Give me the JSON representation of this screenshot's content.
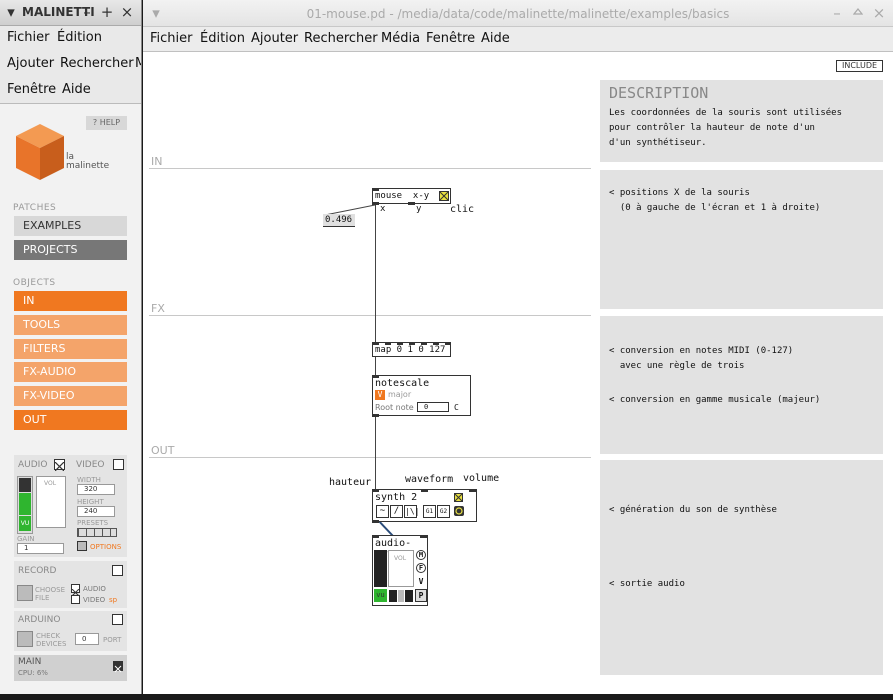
{
  "left_window": {
    "title": "MALINETTI",
    "controls": [
      "▾",
      "–",
      "+",
      "×"
    ],
    "menu": {
      "row1": [
        "Fichier",
        "Édition"
      ],
      "row2": [
        "Ajouter",
        "Rechercher",
        "M"
      ],
      "row3": [
        "Fenêtre",
        "Aide"
      ]
    },
    "help_label": "? HELP",
    "logo_text_1": "la",
    "logo_text_2": "malinette",
    "patches_label": "PATCHES",
    "patches": [
      "EXAMPLES",
      "PROJECTS"
    ],
    "objects_label": "OBJECTS",
    "objects": [
      "IN",
      "TOOLS",
      "FILTERS",
      "FX-AUDIO",
      "FX-VIDEO",
      "OUT"
    ],
    "audio_label": "AUDIO",
    "video_label": "VIDEO",
    "vol_label": "VOL",
    "vu_label": "VU",
    "gain_label": "GAIN",
    "gain_value": "1",
    "width_label": "WIDTH",
    "width_value": "320",
    "height_label": "HEIGHT",
    "height_value": "240",
    "presets_label": "PRESETS",
    "options_label": "OPTIONS",
    "record_label": "RECORD",
    "choose_file_label": "CHOOSE FILE",
    "rec_audio_label": "AUDIO",
    "rec_video_label": "VIDEO",
    "rec_video_suffix": "sp",
    "arduino_label": "ARDUINO",
    "check_devices_label": "CHECK DEVICES",
    "port_value": "0",
    "port_label": "PORT",
    "main_label": "MAIN",
    "cpu_label": "CPU: 6%"
  },
  "main_window": {
    "title": "01-mouse.pd - /media/data/code/malinette/malinette/examples/basics",
    "controls": [
      "▾",
      "–",
      "×"
    ],
    "menu": [
      "Fichier",
      "Édition",
      "Ajouter",
      "Rechercher",
      "Média",
      "Fenêtre",
      "Aide"
    ],
    "include_label": "INCLUDE",
    "sections": [
      "IN",
      "FX",
      "OUT"
    ],
    "description_title": "DESCRIPTION",
    "description_text": "Les coordonnées de la souris sont utilisées\npour contrôler la hauteur de note d'un\nd'un synthétiseur.",
    "comments": [
      "< positions X de la souris\n  (0 à gauche de l'écran et 1 à droite)",
      "< conversion en notes MIDI (0-127)\n  avec une règle de trois",
      "< conversion en gamme musicale (majeur)",
      "< génération du son de synthèse",
      "< sortie audio"
    ],
    "patch": {
      "mouse_obj": "mouse  x-y",
      "mouse_outlets": [
        "x",
        "y",
        "clic"
      ],
      "number_value": "0.496",
      "map_obj": "map 0 1 0 127",
      "notescale_title": "notescale",
      "notescale_mode": "major",
      "root_note_label": "Root note",
      "root_note_value": "0",
      "root_note_name": "C",
      "hauteur_label": "hauteur",
      "waveform_label": "waveform",
      "volume_label": "volume",
      "synth_title": "synth 2",
      "synth_wave_buttons": [
        "~",
        "/",
        "|\\|"
      ],
      "synth_osc_buttons": [
        "G1",
        "G2"
      ],
      "audioout_title": "audio-out",
      "audioout_vol": "VOL",
      "audioout_side_buttons": [
        "M",
        "F",
        "V",
        "P"
      ],
      "audioout_vu": "vu"
    }
  },
  "colors": {
    "orange": "#f07820",
    "orange_light": "#f4a46a",
    "logo_orange": "#e8742a",
    "vu_green": "#2fb52f"
  }
}
